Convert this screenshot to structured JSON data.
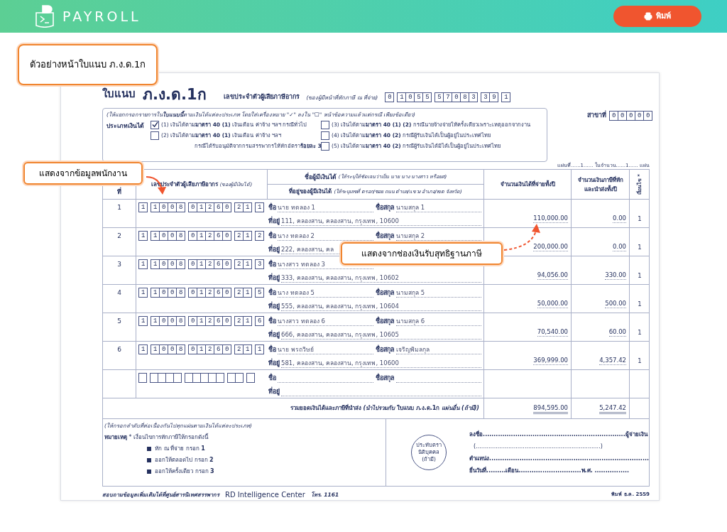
{
  "header": {
    "logo_text": "PAYROLL",
    "print_button": "พิมพ์"
  },
  "page_label": "ตัวอย่างหน้าใบแนบ ภ.ง.ด.1ก",
  "employee_callout": "แสดงจากข้อมูลพนักงาน",
  "income_callout": "แสดงจากช่องเงินรับสุทธิฐานภาษี",
  "form": {
    "form_label": "ใบแนบ",
    "form_code": "ภ.ง.ด.1ก",
    "tin_label": "เลขประจำตัวผู้เสียภาษีอากร",
    "tin_note": "(ของผู้มีหน้าที่หักภาษี ณ ที่จ่าย)",
    "tin": [
      "0",
      "1055",
      "57083",
      "39",
      "1"
    ],
    "branch_label": "สาขาที่",
    "branch": "00000",
    "instruction": "(ให้แยกกรอกรายการใน**ใบแนบนี้**ตามเงินได้แต่ละประเภท  โดยใส่เครื่องหมาย \"✓\" ลงใน \"☐\" หน้าข้อความแล้วแต่กรณี เพียงข้อเดียว)",
    "income_type_label": "ประเภทเงินได้",
    "income_types": [
      {
        "text": "(1) เงินได้ตาม**มาตรา 40 (1)** เงินเดือน ค่าจ้าง ฯลฯ กรณีทั่วไป",
        "checked": true
      },
      {
        "text": "(2) เงินได้ตาม**มาตรา 40 (1)** เงินเดือน ค่าจ้าง ฯลฯ",
        "note": "กรณีได้รับอนุมัติจากกรมสรรพากรให้หักอัตรา**ร้อยละ 3**",
        "checked": false
      },
      {
        "text": "(3) เงินได้ตาม**มาตรา 40 (1) (2)** กรณีนายจ้างจ่ายให้ครั้งเดียวเพราะเหตุออกจากงาน",
        "checked": false
      },
      {
        "text": "(4) เงินได้ตาม**มาตรา 40 (2)** กรณีผู้รับเงินได้เป็นผู้อยู่ในประเทศไทย",
        "checked": false
      },
      {
        "text": "(5) เงินได้ตาม**มาตรา 40 (2)** กรณีผู้รับเงินได้มิได้เป็นผู้อยู่ในประเทศไทย",
        "checked": false
      }
    ],
    "sheet_info": "แผ่นที่......1...... ในจำนวน......1...... แผ่น",
    "table": {
      "columns": {
        "no": "ที่",
        "tin": "เลขประจำตัวผู้เสียภาษีอากร",
        "tin_note": "(ของผู้มีเงินได้)",
        "name": "ชื่อผู้มีเงินได้",
        "name_note": "(ให้ระบุให้ชัดเจนว่าเป็น นาย นาง นางสาว หรือยศ)",
        "address": "ที่อยู่ของผู้มีเงินได้",
        "address_note": "(ให้ระบุเลขที่ ตรอก/ซอย ถนน ตำบล/แขวง อำเภอ/เขต จังหวัด)",
        "income": "จำนวนเงินได้ที่จ่ายทั้งปี",
        "tax": "จำนวนเงินภาษีที่หักและนำส่งทั้งปี",
        "condition": "เงื่อนไข *"
      },
      "rows": [
        {
          "no": "1",
          "tin": [
            "1",
            "1008",
            "01260",
            "21",
            "1"
          ],
          "name_label": "ชื่อ",
          "name": "นาย ทดลอง 1",
          "surname_label": "ชื่อสกุล",
          "surname": "นามสกุล 1",
          "address_label": "ที่อยู่",
          "address": "111, คลองสาน, คลองสาน, กรุงเทพ, 10600",
          "income": "110,000.00",
          "tax": "0.00",
          "condition": "1"
        },
        {
          "no": "2",
          "tin": [
            "1",
            "1008",
            "01260",
            "21",
            "2"
          ],
          "name_label": "ชื่อ",
          "name": "นาง ทดลอง 2",
          "surname_label": "ชื่อสกุล",
          "surname": "นามสกุล 2",
          "address_label": "ที่อยู่",
          "address": "222, คลองสาน, คล",
          "income": "200,000.00",
          "tax": "0.00",
          "condition": "1"
        },
        {
          "no": "3",
          "tin": [
            "1",
            "1008",
            "01260",
            "21",
            "3"
          ],
          "name_label": "ชื่อ",
          "name": "นางสาว ทดลอง 3",
          "address_label": "ที่อยู่",
          "address": "333, คลองสาน, คลองสาน, กรุงเทพ, 10602",
          "income": "94,056.00",
          "tax": "330.00",
          "condition": "1"
        },
        {
          "no": "4",
          "tin": [
            "1",
            "1008",
            "01260",
            "21",
            "5"
          ],
          "name_label": "ชื่อ",
          "name": "นาง ทดลอง 5",
          "surname_label": "ชื่อสกุล",
          "surname": "นามสกุล 5",
          "address_label": "ที่อยู่",
          "address": "555, คลองสาน, คลองสาน, กรุงเทพ, 10604",
          "income": "50,000.00",
          "tax": "500.00",
          "condition": "1"
        },
        {
          "no": "5",
          "tin": [
            "1",
            "1008",
            "01260",
            "21",
            "6"
          ],
          "name_label": "ชื่อ",
          "name": "นางสาว ทดลอง 6",
          "surname_label": "ชื่อสกุล",
          "surname": "นามสกุล 6",
          "address_label": "ที่อยู่",
          "address": "666, คลองสาน, คลองสาน, กรุงเทพ, 10605",
          "income": "70,540.00",
          "tax": "60.00",
          "condition": "1"
        },
        {
          "no": "6",
          "tin": [
            "1",
            "1008",
            "01260",
            "21",
            "1"
          ],
          "name_label": "ชื่อ",
          "name": "นาย พรถวิษย์",
          "surname_label": "ชื่อสกุล",
          "surname": "เจริญพิมลกุล",
          "address_label": "ที่อยู่",
          "address": "581, คลองสาน, คลองสาน, กรุงเทพ, 10600",
          "income": "369,999.00",
          "tax": "4,357.42",
          "condition": "1"
        },
        {
          "name_label": "ชื่อ",
          "surname_label": "ชื่อสกุล",
          "address_label": "ที่อยู่"
        }
      ],
      "total": {
        "label": "รวมยอดเงินได้และภาษีที่นำส่ง *(นำไปรวมกับ* **ใบแนบ ภ.ง.ด.1ก** *แผ่นอื่น (ถ้ามี))*",
        "income": "894,595.00",
        "tax": "5,247.42"
      }
    },
    "footer": {
      "order_note": "(ให้กรอกลำดับที่ต่อเนื่องกันไปทุกแผ่นตามเงินได้แต่ละประเภท)",
      "remark": "**หมายเหตุ** * เงื่อนไขการหักภาษีให้กรอกดังนี้",
      "conditions": [
        "หัก ณ ที่จ่าย กรอก **1**",
        "ออกให้ตลอดไป กรอก **2**",
        "ออกให้ครั้งเดียว กรอก **3**"
      ],
      "seal": "ประทับตรา นิติบุคคล (ถ้ามี)",
      "signature": "ลงชื่อ..................................................................ผู้จ่ายเงิน",
      "signature_name": "(.....................................................................)",
      "position": "ตำแหน่ง..........................................................................",
      "date": "ยื่นวันที่.........เดือน.............................พ.ศ. ................"
    },
    "bottom": {
      "contact": "สอบถามข้อมูลเพิ่มเติมได้ที่ศูนย์สารนิเทศสรรพากร",
      "brand": "RD Intelligence Center",
      "phone": "โทร. 1161",
      "printed": "พิมพ์ ธ.ค. 2559"
    }
  }
}
